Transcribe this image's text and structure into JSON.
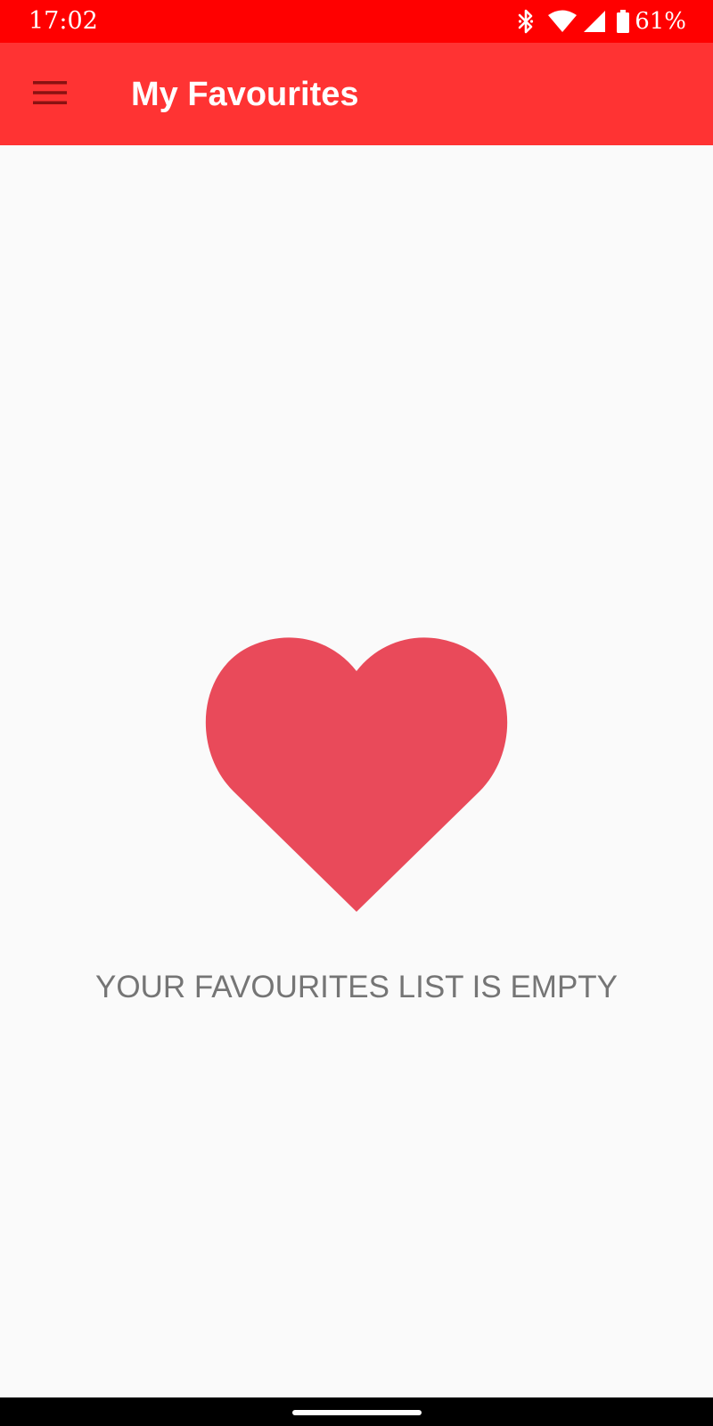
{
  "status_bar": {
    "time": "17:02",
    "battery_percent": "61%",
    "background_color": "#ff0000",
    "icons": [
      "bluetooth-icon",
      "wifi-icon",
      "cell-signal-icon",
      "battery-icon"
    ]
  },
  "app_bar": {
    "title": "My Favourites",
    "menu_icon": "hamburger-menu-icon",
    "background_color": "#ff3333"
  },
  "empty_state": {
    "icon": "heart-icon",
    "icon_color": "#e94a5a",
    "message": "YOUR FAVOURITES LIST IS EMPTY"
  }
}
